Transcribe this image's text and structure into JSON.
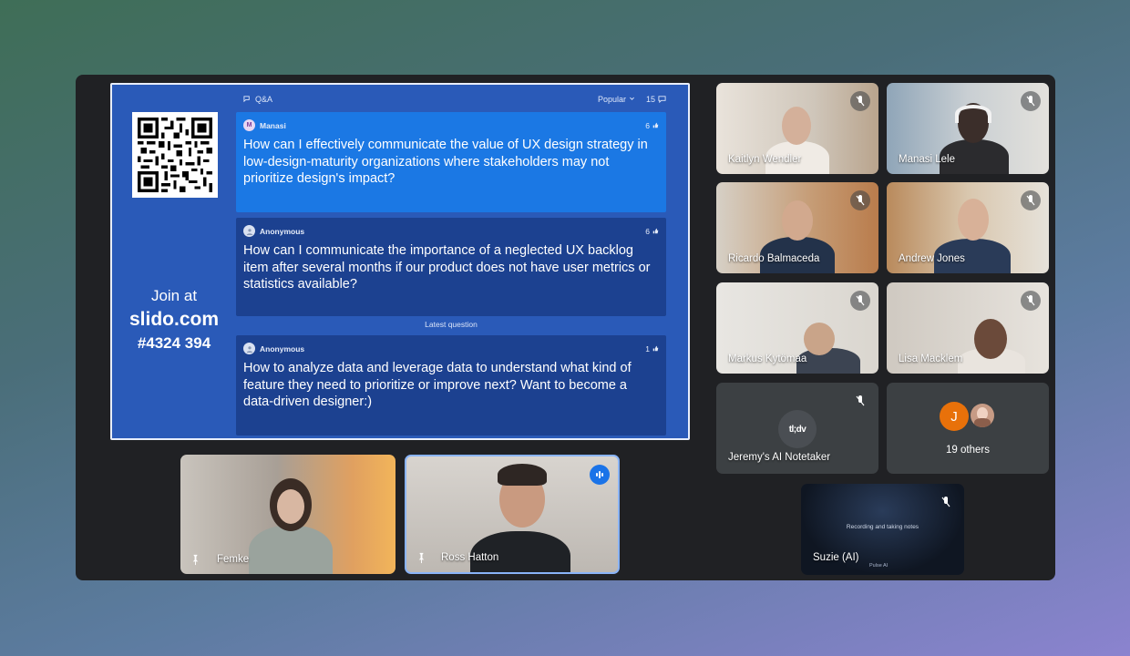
{
  "slido": {
    "join_at": "Join at",
    "url": "slido.com",
    "code": "#4324 394",
    "header_label": "Q&A",
    "sort": "Popular",
    "count": "15",
    "latest_label": "Latest question",
    "questions": [
      {
        "author": "Manasi",
        "likes": "6",
        "text": "How can I effectively communicate the value of UX design strategy in low-design-maturity organizations where stakeholders may not prioritize design's impact?"
      },
      {
        "author": "Anonymous",
        "likes": "6",
        "text": "How can I communicate the importance of a neglected UX backlog item after several months if our product does not have user metrics or statistics available?"
      },
      {
        "author": "Anonymous",
        "likes": "1",
        "text": "How to analyze data and leverage data to understand what kind of feature they need to prioritize or improve next? Want to become a data-driven designer:)"
      }
    ]
  },
  "participants": {
    "p1": "Kaitlyn Wendler",
    "p2": "Manasi Lele",
    "p3": "Ricardo Balmaceda",
    "p4": "Andrew Jones",
    "p5": "Markus Kytömaa",
    "p6": "Lisa Macklem",
    "notetaker": "Jeremy's AI Notetaker",
    "notetaker_logo": "tl;dv",
    "others_initial": "J",
    "others": "19 others",
    "suzie": "Suzie (AI)",
    "suzie_caption": "Recording and taking notes",
    "suzie_sub": "Pulse AI",
    "femke": "Femke",
    "ross": "Ross Hatton"
  },
  "colors": {
    "slido_bg": "#2a5ab8",
    "highlight_card": "#1b78e4",
    "normal_card": "#1c4190",
    "speaking": "#1a73e8",
    "others_avatar": "#e8710a"
  },
  "icons": [
    "qr-code-icon",
    "qa-icon",
    "chevron-down-icon",
    "comment-icon",
    "thumbs-up-icon",
    "mic-off-icon",
    "pin-icon",
    "speaking-icon"
  ]
}
